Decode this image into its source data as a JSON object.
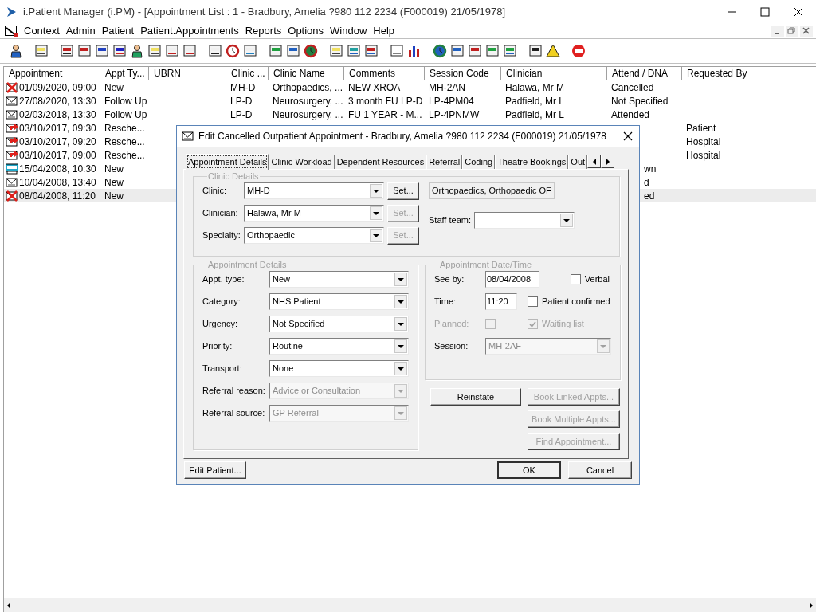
{
  "window": {
    "title": "i.Patient Manager (i.PM) - [Appointment List : 1 - Bradbury, Amelia ?980 112 2234 (F000019) 21/05/1978]"
  },
  "menu": [
    "Context",
    "Admin",
    "Patient",
    "Patient.Appointments",
    "Reports",
    "Options",
    "Window",
    "Help"
  ],
  "table": {
    "columns": [
      "Appointment",
      "Appt Ty...",
      "UBRN",
      "Clinic ...",
      "Clinic Name",
      "Comments",
      "Session Code",
      "Clinician",
      "Attend / DNA",
      "Requested By"
    ],
    "rows": [
      {
        "kind": "cancelled",
        "selected": false,
        "appointment": "01/09/2020, 09:00",
        "appt_type": "New",
        "clinic": "MH-D",
        "clinic_name": "Orthopaedics, ...",
        "comments": "NEW XROA",
        "session_code": "MH-2AN",
        "clinician": "Halawa, Mr M",
        "attend_dna": "Cancelled"
      },
      {
        "kind": "letter",
        "selected": false,
        "appointment": "27/08/2020, 13:30",
        "appt_type": "Follow Up",
        "clinic": "LP-D",
        "clinic_name": "Neurosurgery, ...",
        "comments": "3 month FU LP-D",
        "session_code": "LP-4PM04",
        "clinician": "Padfield, Mr L",
        "attend_dna": "Not Specified"
      },
      {
        "kind": "letter",
        "selected": false,
        "appointment": "02/03/2018, 13:30",
        "appt_type": "Follow Up",
        "clinic": "LP-D",
        "clinic_name": "Neurosurgery, ...",
        "comments": "FU 1 YEAR - M...",
        "session_code": "LP-4PNMW",
        "clinician": "Padfield, Mr L",
        "attend_dna": "Attended"
      },
      {
        "kind": "rescheduled",
        "selected": false,
        "appointment": "03/10/2017, 09:30",
        "appt_type": "Resche...",
        "requested_by": "Patient"
      },
      {
        "kind": "rescheduled",
        "selected": false,
        "appointment": "03/10/2017, 09:20",
        "appt_type": "Resche...",
        "requested_by": "Hospital"
      },
      {
        "kind": "rescheduled",
        "selected": false,
        "appointment": "03/10/2017, 09:00",
        "appt_type": "Resche...",
        "requested_by": "Hospital"
      },
      {
        "kind": "dna",
        "selected": false,
        "appointment": "15/04/2008, 10:30",
        "appt_type": "New",
        "attend_dna": "wn",
        "attend_cut_off": true
      },
      {
        "kind": "letter",
        "selected": false,
        "appointment": "10/04/2008, 13:40",
        "appt_type": "New",
        "attend_dna": "d",
        "attend_cut_off": true
      },
      {
        "kind": "cancelled",
        "selected": true,
        "appointment": "08/04/2008, 11:20",
        "appt_type": "New",
        "attend_dna": "ed",
        "attend_cut_off": true
      }
    ]
  },
  "dialog": {
    "title": "Edit Cancelled Outpatient Appointment - Bradbury, Amelia ?980 112 2234 (F000019) 21/05/1978",
    "tabs": [
      {
        "label": "Appointment Details",
        "selected": true
      },
      {
        "label": "Clinic Workload",
        "selected": false
      },
      {
        "label": "Dependent Resources",
        "selected": false
      },
      {
        "label": "Referral",
        "selected": false
      },
      {
        "label": "Coding",
        "selected": false
      },
      {
        "label": "Theatre Bookings",
        "selected": false
      },
      {
        "label": "Out",
        "selected": false
      }
    ],
    "clinic_details": {
      "legend": "Clinic Details",
      "fields": [
        {
          "label": "Clinic:",
          "value": "MH-D",
          "set_button": {
            "label": "Set...",
            "disabled": false
          }
        },
        {
          "label": "Clinician:",
          "value": "Halawa, Mr M",
          "set_button": {
            "label": "Set...",
            "disabled": true
          }
        },
        {
          "label": "Specialty:",
          "value": "Orthopaedic",
          "set_button": {
            "label": "Set...",
            "disabled": true
          }
        }
      ],
      "clinic_name": "Orthopaedics, Orthopaedic OF",
      "staff_team": {
        "label": "Staff team:"
      }
    },
    "appointment_details": {
      "legend": "Appointment Details",
      "fields": [
        {
          "label": "Appt. type:",
          "value": "New",
          "disabled": false
        },
        {
          "label": "Category:",
          "value": "NHS Patient",
          "disabled": false
        },
        {
          "label": "Urgency:",
          "value": "Not Specified",
          "disabled": false
        },
        {
          "label": "Priority:",
          "value": "Routine",
          "disabled": false
        },
        {
          "label": "Transport:",
          "value": "None",
          "disabled": false
        },
        {
          "label": "Referral reason:",
          "value": "Advice or Consultation",
          "disabled": true
        },
        {
          "label": "Referral source:",
          "value": "GP Referral",
          "disabled": true
        }
      ]
    },
    "date_time": {
      "legend": "Appointment Date/Time",
      "see_by": {
        "label": "See by:",
        "value": "08/04/2008"
      },
      "verbal": {
        "label": "Verbal",
        "checked": false,
        "disabled": false
      },
      "time": {
        "label": "Time:",
        "value": "11:20"
      },
      "patient_confirmed": {
        "label": "Patient confirmed",
        "checked": false,
        "disabled": false
      },
      "planned": {
        "label": "Planned:",
        "checked": false,
        "disabled": true
      },
      "waiting_list": {
        "label": "Waiting list",
        "checked": true,
        "disabled": true
      },
      "session": {
        "label": "Session:",
        "value": "MH-2AF",
        "disabled": true
      }
    },
    "action_buttons": [
      {
        "label": "Reinstate",
        "disabled": false
      },
      {
        "label": "Book Linked Appts...",
        "disabled": true
      },
      {
        "label": "Book Multiple Appts...",
        "disabled": true
      },
      {
        "label": "Find Appointment...",
        "disabled": true
      }
    ],
    "edit_patient_button": {
      "label": "Edit Patient..."
    },
    "footer_buttons": [
      {
        "label": "OK",
        "default": true
      },
      {
        "label": "Cancel",
        "default": false
      }
    ]
  }
}
